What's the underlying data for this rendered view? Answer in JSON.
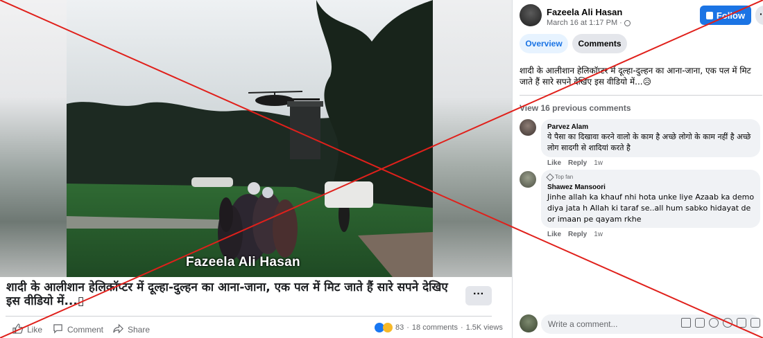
{
  "video": {
    "watermark": "Fazeela Ali Hasan",
    "caption": "शादी के आलीशान हेलिकॉप्टर में दूल्हा-दुल्हन का आना-जाना, एक पल में मिट जाते हैं सारे सपने देखिए इस वीडियो में...▯",
    "more_label": "···"
  },
  "actions": {
    "like": "Like",
    "comment": "Comment",
    "share": "Share"
  },
  "stats": {
    "reactions": "83",
    "comments": "18 comments",
    "views": "1.5K views",
    "sep": "·"
  },
  "post": {
    "author": "Fazeela Ali Hasan",
    "time": "March 16 at 1:17 PM · ",
    "follow_label": "Follow",
    "more_label": "···",
    "tab_overview": "Overview",
    "tab_comments": "Comments",
    "text": "शादी के आलीशान हेलिकॉप्टर में दूल्हा-दुल्हन का आना-जाना, एक पल में मिट जाते हैं सारे सपने देखिए इस वीडियो में...😥"
  },
  "comments": {
    "view_previous": "View 16 previous comments",
    "items": [
      {
        "name": "Parvez Alam",
        "text": "ये पैसा का दिखावा करने वालो के काम है अच्छे लोगो के काम नहीं है अच्छे लोग सादगी से शादियां करते है",
        "like": "Like",
        "reply": "Reply",
        "age": "1w"
      },
      {
        "badge": "Top fan",
        "name": "Shawez Mansoori",
        "text": "Jinhe allah ka khauf nhi hota unke liye Azaab ka demo diya jata h Allah ki taraf se..all hum sabko hidayat de or imaan pe qayam rkhe",
        "like": "Like",
        "reply": "Reply",
        "age": "1w"
      }
    ],
    "write_placeholder": "Write a comment..."
  },
  "colors": {
    "accent": "#1b74e4",
    "overlay_cross": "#e0201b"
  }
}
